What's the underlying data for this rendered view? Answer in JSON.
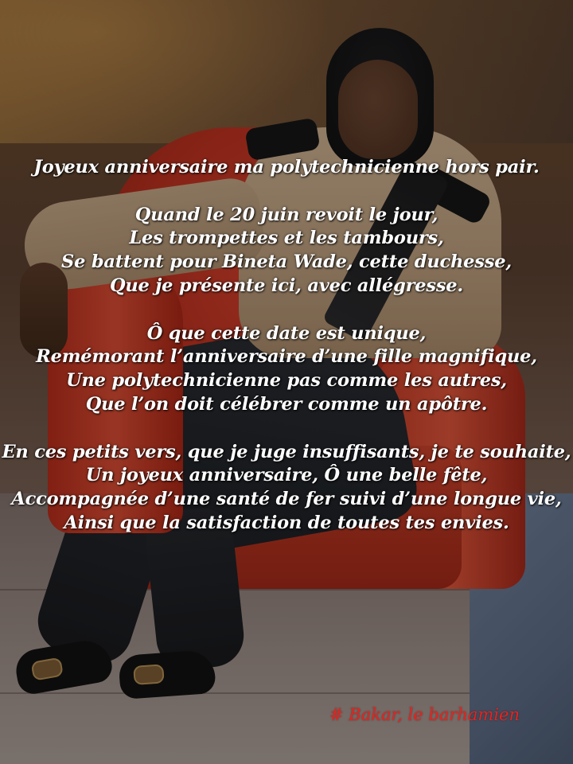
{
  "poem": {
    "title": "Joyeux anniversaire ma polytechnicienne hors pair.",
    "stanza1": [
      "Quand le 20 juin revoit le jour,",
      "Les trompettes et les tambours,",
      "Se battent pour Bineta Wade, cette duchesse,",
      "Que je présente ici, avec allégresse."
    ],
    "stanza2": [
      "Ô que cette date est unique,",
      "Remémorant l’anniversaire d’une fille magnifique,",
      "Une polytechnicienne pas comme les autres,",
      "Que l’on doit célébrer comme un apôtre."
    ],
    "stanza3": [
      "En ces petits vers, que je juge insuffisants, je te souhaite,",
      "Un joyeux anniversaire, Ô une belle fête,",
      "Accompagnée d’une santé de fer suivi d’une longue vie,",
      "Ainsi que  la satisfaction de toutes tes envies."
    ]
  },
  "signature": "# Bakar, le barhamien",
  "colors": {
    "poem_text": "#ffffff",
    "signature": "#e8231e",
    "chair": "#c5402a"
  }
}
